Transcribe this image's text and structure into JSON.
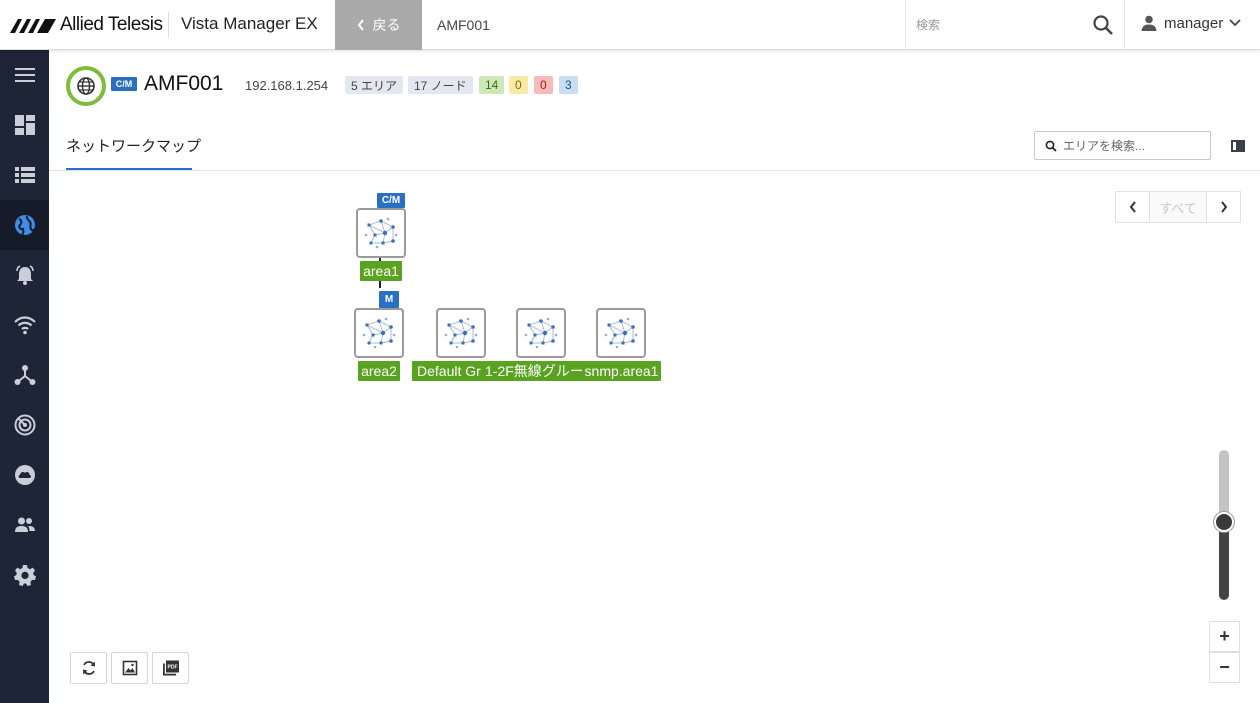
{
  "header": {
    "brand": "Allied Telesis",
    "product": "Vista Manager EX",
    "back_label": "戻る",
    "breadcrumb": "AMF001",
    "search_placeholder": "検索",
    "user": "manager"
  },
  "sidebar": {
    "items": [
      {
        "icon": "menu-icon"
      },
      {
        "icon": "dashboard-icon"
      },
      {
        "icon": "list-icon"
      },
      {
        "icon": "globe-icon",
        "active": true
      },
      {
        "icon": "alarm-bell-icon"
      },
      {
        "icon": "wifi-icon"
      },
      {
        "icon": "topology-icon"
      },
      {
        "icon": "radar-icon"
      },
      {
        "icon": "cloud-icon"
      },
      {
        "icon": "users-icon"
      },
      {
        "icon": "settings-icon"
      }
    ]
  },
  "network": {
    "badge": "C/M",
    "name": "AMF001",
    "ip": "192.168.1.254",
    "areas": "5 エリア",
    "nodes": "17 ノード",
    "count_green": "14",
    "count_yellow": "0",
    "count_red": "0",
    "count_blue": "3"
  },
  "tabs": {
    "network_map": "ネットワークマップ",
    "area_search_placeholder": "エリアを検索..."
  },
  "pager": {
    "label": "すべて"
  },
  "map": {
    "nodes": [
      {
        "label": "area1",
        "badge": "C/M"
      },
      {
        "label": "area2",
        "badge": "M"
      },
      {
        "label": "Default Gr",
        "badge": ""
      },
      {
        "label": "1-2F無線グルー",
        "badge": ""
      },
      {
        "label": "snmp.area1",
        "badge": ""
      }
    ]
  },
  "zoom": {
    "level": 0.52,
    "plus": "+",
    "minus": "−"
  },
  "colors": {
    "accent": "#2b6fc4",
    "status_green": "#5aa320",
    "sidebar": "#1d2536"
  }
}
